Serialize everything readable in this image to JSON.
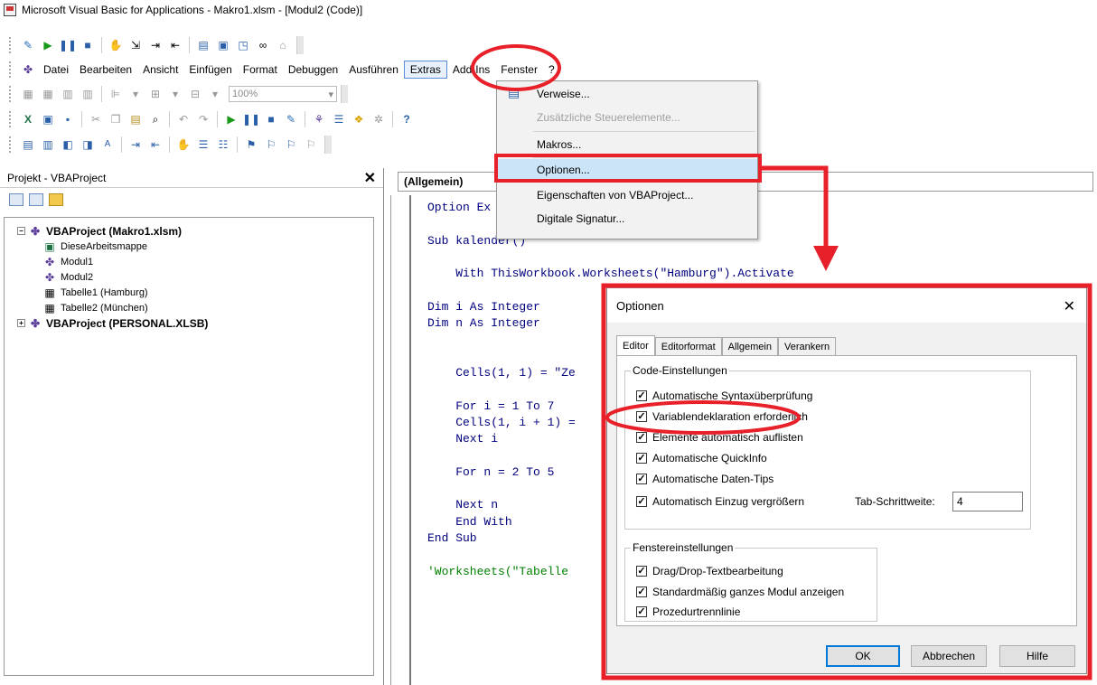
{
  "window": {
    "title": "Microsoft Visual Basic for Applications - Makro1.xlsm - [Modul2 (Code)]"
  },
  "menu": [
    "Datei",
    "Bearbeiten",
    "Ansicht",
    "Einfügen",
    "Format",
    "Debuggen",
    "Ausführen",
    "Extras",
    "Add-Ins",
    "Fenster",
    "?"
  ],
  "toolbar": {
    "zoom_value": "100%"
  },
  "project_panel": {
    "title": "Projekt - VBAProject",
    "tree": {
      "root1": "VBAProject (Makro1.xlsm)",
      "children": [
        "DieseArbeitsmappe",
        "Modul1",
        "Modul2",
        "Tabelle1 (Hamburg)",
        "Tabelle2 (München)"
      ],
      "root2": "VBAProject (PERSONAL.XLSB)"
    }
  },
  "code": {
    "object_combo": "(Allgemein)",
    "lines": [
      "Option Ex",
      "",
      "Sub kalender()",
      "",
      "    With ThisWorkbook.Worksheets(\"Hamburg\").Activate",
      "",
      "Dim i As Integer",
      "Dim n As Integer",
      "",
      "",
      "    Cells(1, 1) = \"Ze",
      "",
      "    For i = 1 To 7",
      "    Cells(1, i + 1) =",
      "    Next i",
      "",
      "    For n = 2 To 5",
      "",
      "    Next n",
      "    End With",
      "End Sub",
      "",
      "'Worksheets(\"Tabelle"
    ]
  },
  "extras_menu": {
    "items": [
      "Verweise...",
      "Zusätzliche Steuerelemente...",
      "Makros...",
      "Optionen...",
      "Eigenschaften von VBAProject...",
      "Digitale Signatur..."
    ]
  },
  "options_dialog": {
    "title": "Optionen",
    "tabs": [
      "Editor",
      "Editorformat",
      "Allgemein",
      "Verankern"
    ],
    "code_group": {
      "legend": "Code-Einstellungen",
      "options": [
        "Automatische Syntaxüberprüfung",
        "Variablendeklaration erforderlich",
        "Elemente automatisch auflisten",
        "Automatische QuickInfo",
        "Automatische Daten-Tips",
        "Automatisch Einzug vergrößern"
      ],
      "tab_width_label": "Tab-Schrittweite:",
      "tab_width_value": "4"
    },
    "window_group": {
      "legend": "Fenstereinstellungen",
      "options": [
        "Drag/Drop-Textbearbeitung",
        "Standardmäßig ganzes Modul anzeigen",
        "Prozedurtrennlinie"
      ]
    },
    "buttons": {
      "ok": "OK",
      "cancel": "Abbrechen",
      "help": "Hilfe"
    },
    "check_mark": "✓"
  },
  "annotation_color": "#e8202a"
}
